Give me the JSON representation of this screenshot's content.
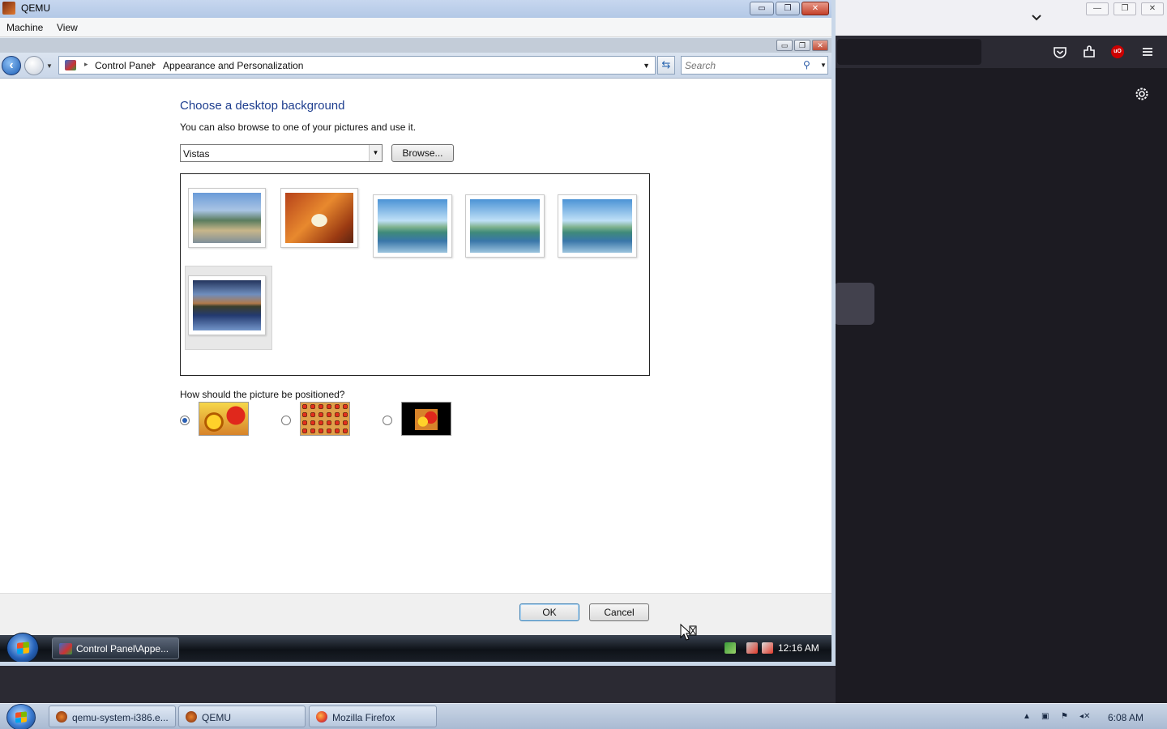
{
  "host_window": {
    "title": "QEMU",
    "menu": [
      "Machine",
      "View"
    ],
    "controls": {
      "minimize": "▭",
      "restore": "❐",
      "close": "✕"
    }
  },
  "explorer": {
    "address": {
      "crumbs": [
        "Control Panel",
        "Appearance and Personalization"
      ],
      "separator": "▸"
    },
    "search": {
      "placeholder": "Search"
    }
  },
  "page": {
    "heading": "Choose a desktop background",
    "subheading": "You can also browse to one of your pictures and use it.",
    "location_selected": "Vistas",
    "browse_label": "Browse...",
    "thumbnails": [
      {
        "name": "wallpaper-waterfront",
        "selected": false
      },
      {
        "name": "wallpaper-rock-arch",
        "selected": false
      },
      {
        "name": "wallpaper-lake-1",
        "selected": false
      },
      {
        "name": "wallpaper-lake-2",
        "selected": false
      },
      {
        "name": "wallpaper-lake-3",
        "selected": false
      },
      {
        "name": "wallpaper-mountain-reflection",
        "selected": true
      }
    ],
    "position_question": "How should the picture be positioned?",
    "position_options": [
      {
        "name": "fit-to-screen",
        "selected": true
      },
      {
        "name": "tile",
        "selected": false
      },
      {
        "name": "center",
        "selected": false
      }
    ],
    "ok_label": "OK",
    "cancel_label": "Cancel"
  },
  "guest_taskbar": {
    "task_button": "Control Panel\\Appe...",
    "clock": "12:16 AM"
  },
  "host_taskbar": {
    "buttons": [
      "qemu-system-i386.e...",
      "QEMU",
      "Mozilla Firefox"
    ],
    "clock": "6:08 AM"
  },
  "firefox": {
    "icons": [
      "chevron-down-icon",
      "pocket-icon",
      "extensions-icon",
      "ublock-icon",
      "hamburger-menu-icon",
      "gear-icon"
    ],
    "ublock_badge": "uO"
  }
}
